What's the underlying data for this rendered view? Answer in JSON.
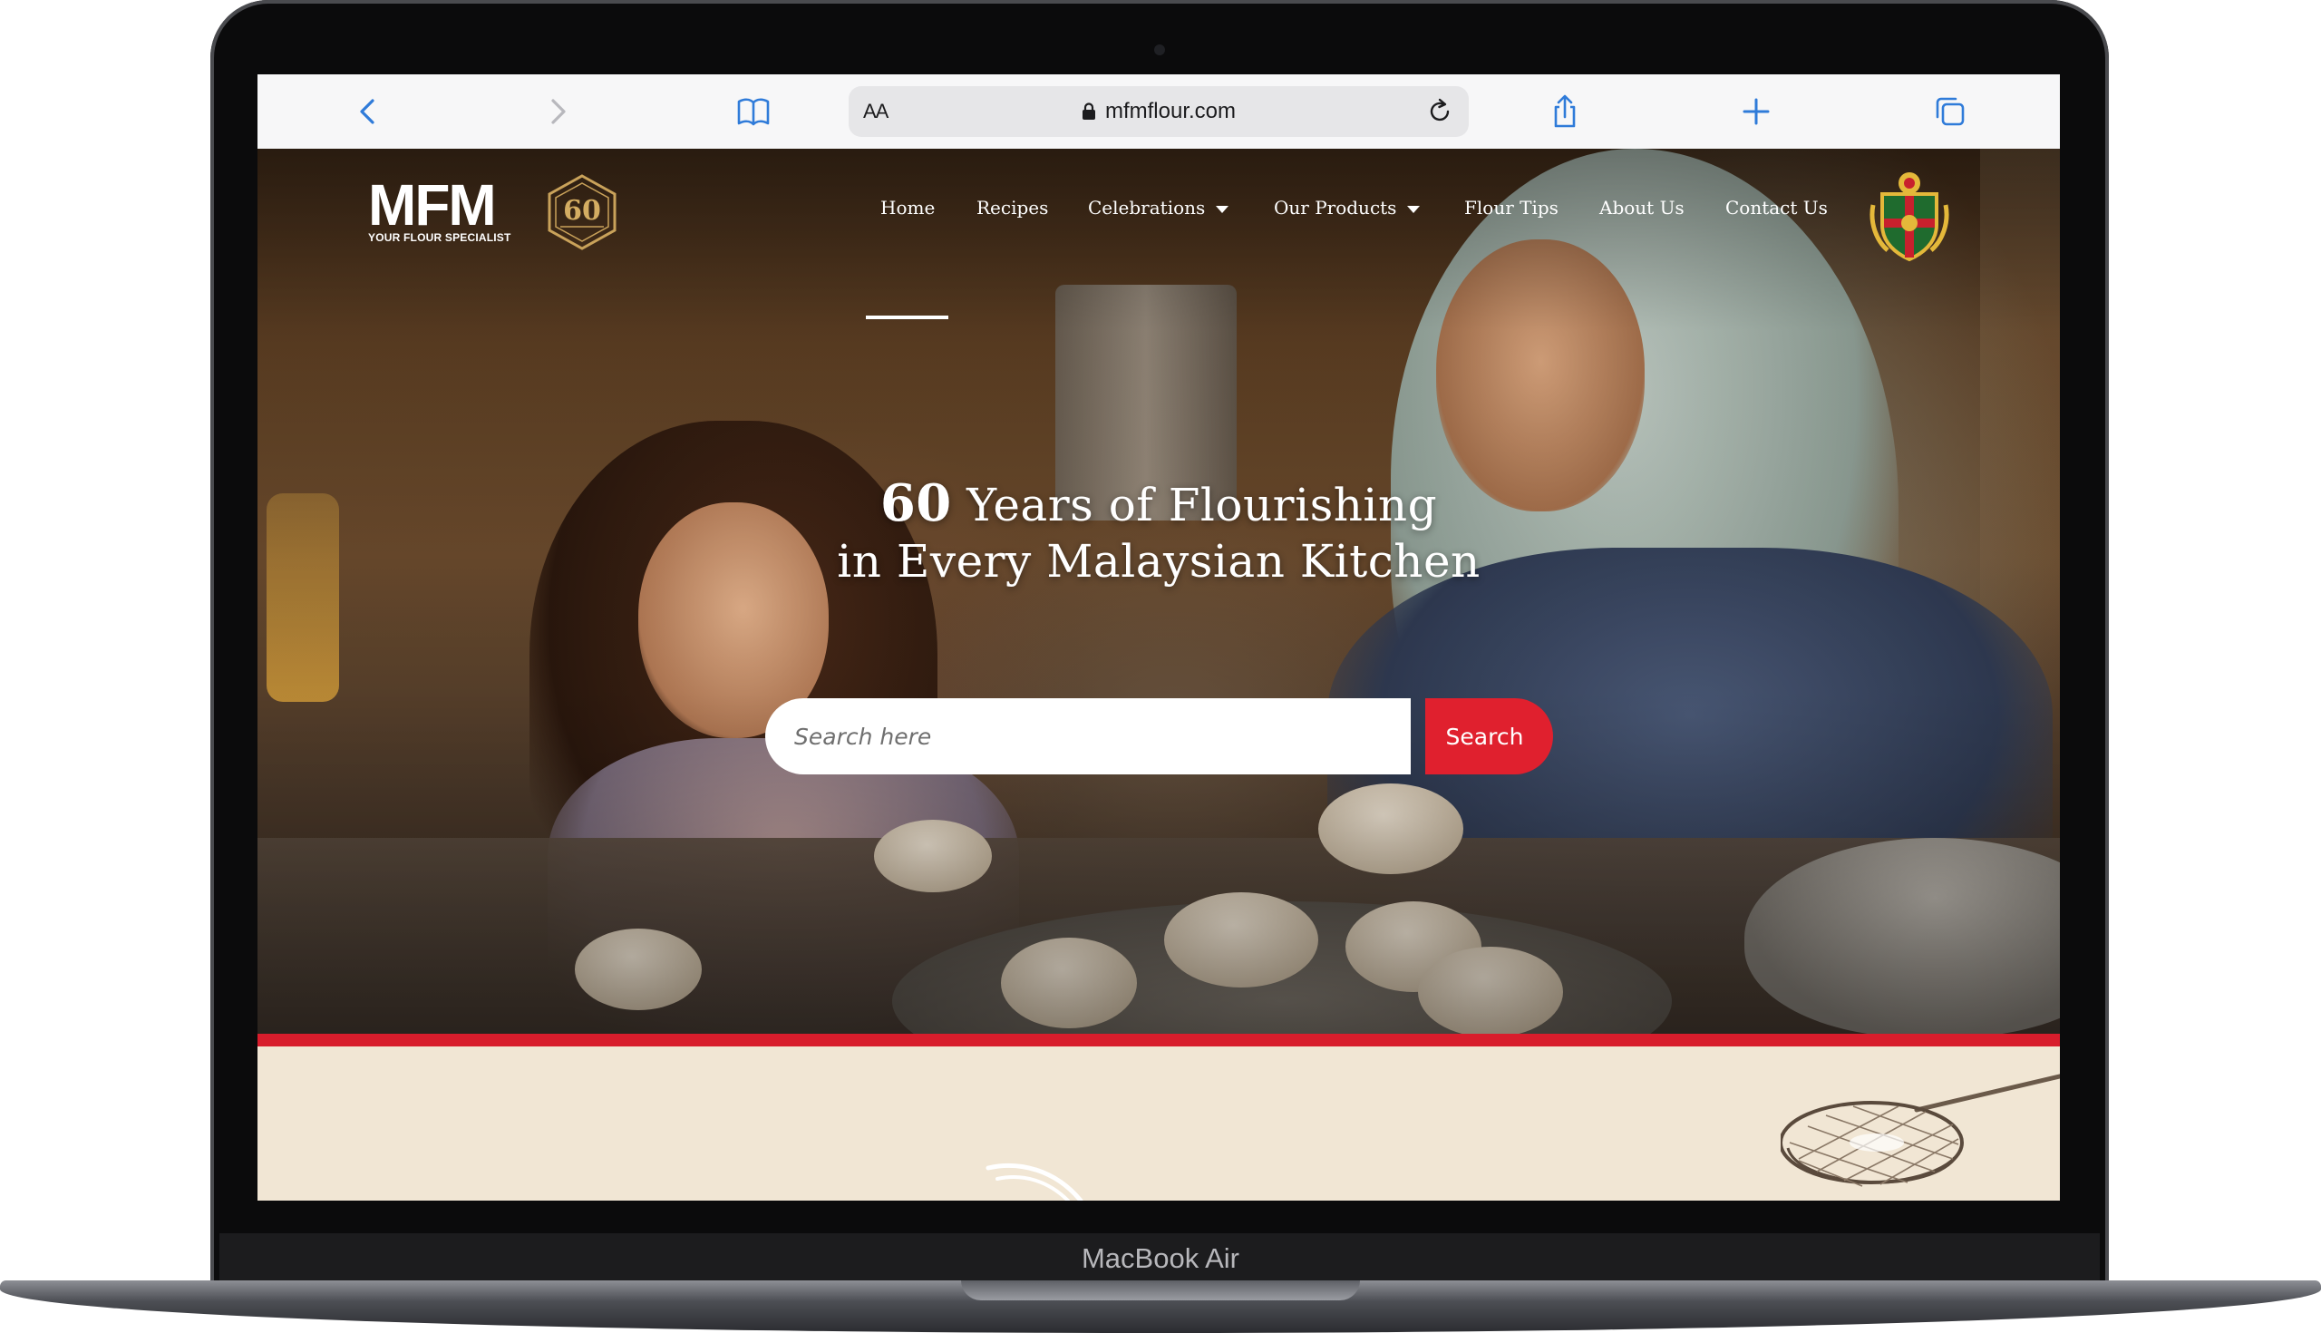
{
  "browser": {
    "text_size_label": "AA",
    "url": "mfmflour.com"
  },
  "site": {
    "logo_text": "MFM",
    "logo_tagline": "YOUR FLOUR SPECIALIST",
    "badge_number": "60"
  },
  "nav": {
    "items": [
      {
        "label": "Home",
        "active": true
      },
      {
        "label": "Recipes"
      },
      {
        "label": "Celebrations",
        "has_dropdown": true
      },
      {
        "label": "Our Products",
        "has_dropdown": true
      },
      {
        "label": "Flour Tips"
      },
      {
        "label": "About Us"
      },
      {
        "label": "Contact Us"
      }
    ]
  },
  "hero": {
    "headline_number": "60",
    "headline_line1_rest": " Years of Flourishing",
    "headline_line2": "in Every Malaysian Kitchen",
    "search_placeholder": "Search here",
    "search_button": "Search"
  },
  "device": {
    "label": "MacBook Air"
  },
  "colors": {
    "accent_red": "#e0202e",
    "cream_section": "#f1e6d4",
    "browser_icon_blue": "#2f7bd9"
  },
  "icons": [
    "back-chevron-icon",
    "forward-chevron-icon",
    "bookmarks-book-icon",
    "lock-icon",
    "reload-icon",
    "share-icon",
    "new-tab-plus-icon",
    "tabs-overview-icon",
    "dropdown-caret-icon"
  ]
}
